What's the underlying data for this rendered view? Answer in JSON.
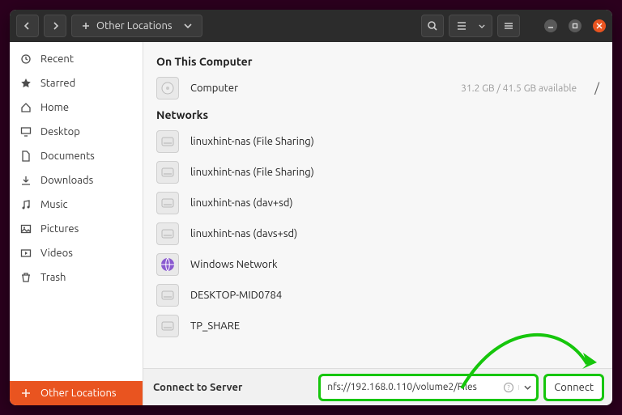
{
  "titlebar": {
    "location_label": "Other Locations"
  },
  "sidebar": [
    {
      "icon": "clock-icon",
      "label": "Recent"
    },
    {
      "icon": "star-icon",
      "label": "Starred"
    },
    {
      "icon": "home-icon",
      "label": "Home"
    },
    {
      "icon": "desktop-icon",
      "label": "Desktop"
    },
    {
      "icon": "documents-icon",
      "label": "Documents"
    },
    {
      "icon": "downloads-icon",
      "label": "Downloads"
    },
    {
      "icon": "music-icon",
      "label": "Music"
    },
    {
      "icon": "pictures-icon",
      "label": "Pictures"
    },
    {
      "icon": "videos-icon",
      "label": "Videos"
    },
    {
      "icon": "trash-icon",
      "label": "Trash"
    },
    {
      "icon": "plus-icon",
      "label": "Other Locations",
      "active": true
    }
  ],
  "sections": {
    "this_computer": {
      "heading": "On This Computer",
      "rows": [
        {
          "label": "Computer",
          "meta": "31.2 GB / 41.5 GB available",
          "chevron": "/"
        }
      ]
    },
    "networks": {
      "heading": "Networks",
      "rows": [
        {
          "label": "linuxhint-nas (File Sharing)"
        },
        {
          "label": "linuxhint-nas (File Sharing)"
        },
        {
          "label": "linuxhint-nas (dav+sd)"
        },
        {
          "label": "linuxhint-nas (davs+sd)"
        },
        {
          "label": "Windows Network",
          "wn": true
        },
        {
          "label": "DESKTOP-MID0784"
        },
        {
          "label": "TP_SHARE"
        }
      ]
    }
  },
  "footer": {
    "label": "Connect to Server",
    "address": "nfs://192.168.0.110/volume2/Files",
    "connect": "Connect"
  }
}
